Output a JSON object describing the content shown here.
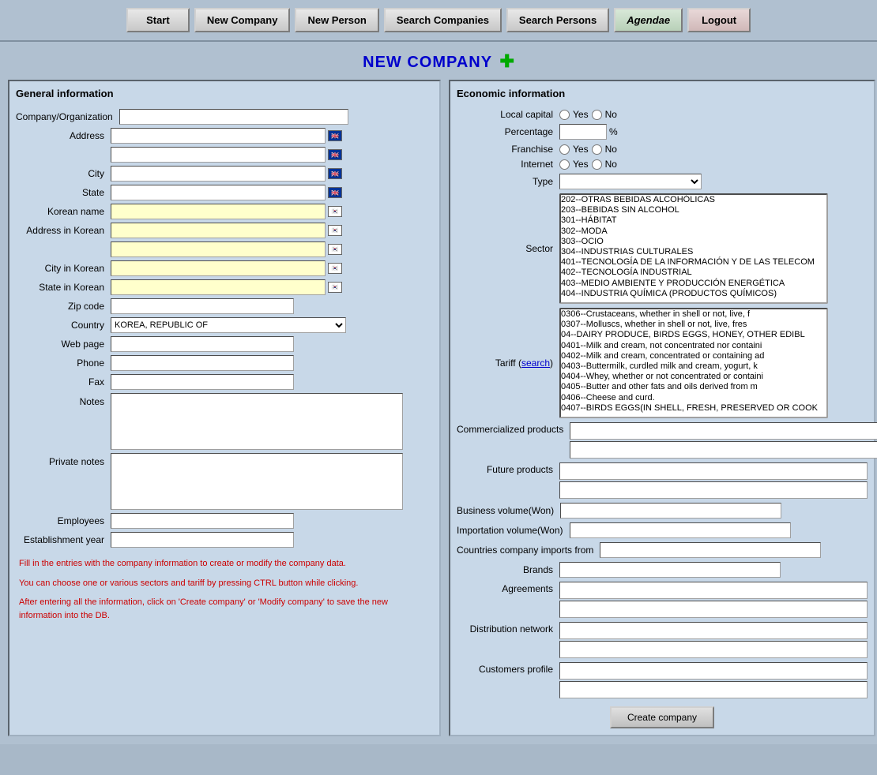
{
  "nav": {
    "start_label": "Start",
    "new_company_label": "New Company",
    "new_person_label": "New Person",
    "search_companies_label": "Search Companies",
    "search_persons_label": "Search Persons",
    "agendae_label": "Agendae",
    "logout_label": "Logout"
  },
  "page_title": "NEW COMPANY",
  "plus_icon": "✚",
  "general_info": {
    "section_title": "General information",
    "company_label": "Company/Organization",
    "address_label": "Address",
    "city_label": "City",
    "state_label": "State",
    "korean_name_label": "Korean name",
    "address_korean_label": "Address in Korean",
    "city_korean_label": "City in Korean",
    "state_korean_label": "State in Korean",
    "zip_code_label": "Zip code",
    "country_label": "Country",
    "country_value": "KOREA, REPUBLIC OF",
    "webpage_label": "Web page",
    "phone_label": "Phone",
    "fax_label": "Fax",
    "notes_label": "Notes",
    "private_notes_label": "Private notes",
    "employees_label": "Employees",
    "establishment_year_label": "Establishment year"
  },
  "economic_info": {
    "section_title": "Economic information",
    "local_capital_label": "Local capital",
    "yes_label": "Yes",
    "no_label": "No",
    "percentage_label": "Percentage",
    "pct_symbol": "%",
    "franchise_label": "Franchise",
    "internet_label": "Internet",
    "type_label": "Type",
    "sector_label": "Sector",
    "tariff_label": "Tariff",
    "tariff_search": "search",
    "tariff_open": "(",
    "tariff_close": ")",
    "comm_products_label": "Commercialized products",
    "future_products_label": "Future products",
    "business_volume_label": "Business volume(Won)",
    "importation_volume_label": "Importation volume(Won)",
    "countries_imports_label": "Countries company imports from",
    "brands_label": "Brands",
    "agreements_label": "Agreements",
    "distribution_network_label": "Distribution network",
    "customers_profile_label": "Customers profile"
  },
  "sector_options": [
    "202--OTRAS BEBIDAS ALCOHÓLICAS",
    "203--BEBIDAS SIN ALCOHOL",
    "301--HÁBITAT",
    "302--MODA",
    "303--OCIO",
    "304--INDUSTRIAS CULTURALES",
    "401--TECNOLOGÍA DE LA INFORMACIÓN Y DE LAS TELECOM",
    "402--TECNOLOGÍA INDUSTRIAL",
    "403--MEDIO AMBIENTE Y PRODUCCIÓN ENERGÉTICA",
    "404--INDUSTRIA QUÍMICA (PRODUCTOS QUÍMICOS)"
  ],
  "tariff_options": [
    "0306--Crustaceans, whether in shell or not, live, f",
    "0307--Molluscs, whether in shell or not, live, fres",
    "04--DAIRY PRODUCE, BIRDS EGGS, HONEY, OTHER EDIBL",
    "0401--Milk and cream, not concentrated nor containi",
    "0402--Milk and cream, concentrated or containing ad",
    "0403--Buttermilk, curdled milk and cream, yogurt, k",
    "0404--Whey, whether or not concentrated or containi",
    "0405--Butter and other fats and oils derived from m",
    "0406--Cheese and curd.",
    "0407--BIRDS EGGS(IN SHELL, FRESH, PRESERVED OR COOK"
  ],
  "country_options": [
    "KOREA, REPUBLIC OF"
  ],
  "info_messages": {
    "fill_info": "Fill in the entries with the company information to create or modify the company data.",
    "ctrl_info": "You can choose one or various sectors and tariff by pressing CTRL button while clicking.",
    "after_info": "After entering all the information, click on 'Create company' or 'Modify company' to save the new information into the DB."
  },
  "create_btn_label": "Create company"
}
